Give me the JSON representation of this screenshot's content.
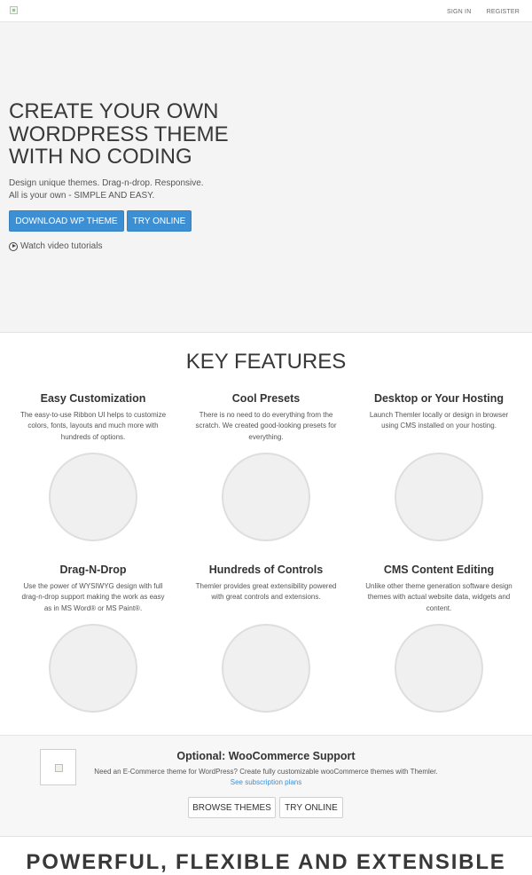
{
  "header": {
    "nav": [
      "SIGN IN",
      "REGISTER"
    ]
  },
  "hero": {
    "title": "CREATE YOUR OWN WORDPRESS THEME WITH NO CODING",
    "subtitle_line1": "Design unique themes. Drag-n-drop. Responsive.",
    "subtitle_line2": "All is your own - SIMPLE AND EASY.",
    "download_button": "DOWNLOAD WP THEME",
    "try_button": "TRY ONLINE",
    "video_link": "Watch video tutorials"
  },
  "features": {
    "title": "KEY FEATURES",
    "items": [
      {
        "title": "Easy Customization",
        "text": "The easy-to-use Ribbon UI helps to customize colors, fonts, layouts and much more with hundreds of options."
      },
      {
        "title": "Cool Presets",
        "text": "There is no need to do everything from the scratch. We created good-looking presets for everything."
      },
      {
        "title": "Desktop or Your Hosting",
        "text": "Launch Themler locally or design in browser using CMS installed on your hosting."
      },
      {
        "title": "Drag-N-Drop",
        "text": "Use the power of WYSIWYG design with full drag-n-drop support making the work as easy as in MS Word® or MS Paint®."
      },
      {
        "title": "Hundreds of Controls",
        "text": "Themler provides great extensibility powered with great controls and extensions."
      },
      {
        "title": "CMS Content Editing",
        "text": "Unlike other theme generation software design themes with actual website data, widgets and content."
      }
    ]
  },
  "woocommerce": {
    "title": "Optional: WooCommerce Support",
    "text": "Need an E-Commerce theme for WordPress? Create fully customizable wooCommerce themes with Themler.",
    "link": "See subscription plans",
    "browse_button": "BROWSE THEMES",
    "try_button": "TRY ONLINE"
  },
  "bottom": {
    "title": "POWERFUL, FLEXIBLE AND EXTENSIBLE"
  }
}
